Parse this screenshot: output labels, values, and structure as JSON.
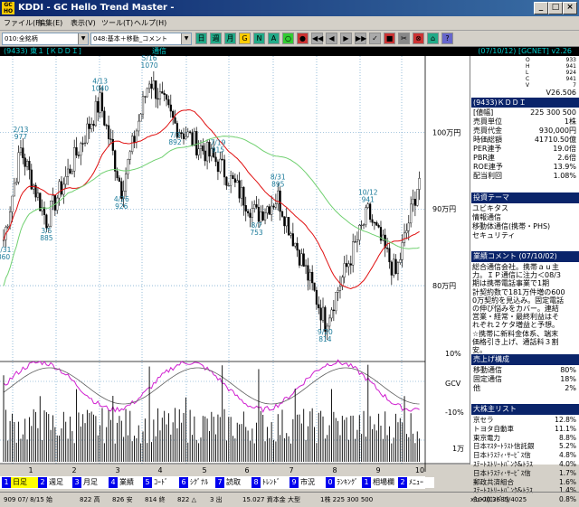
{
  "window": {
    "icon_text": "GC HO",
    "title": "KDDI - GC Hello Trend Master -",
    "btn_min": "_",
    "btn_max": "□",
    "btn_close": "×"
  },
  "menu": [
    "ファイル(F)",
    "編集(E)",
    "表示(V)",
    "ツール(T)",
    "ヘルプ(H)"
  ],
  "toolbar": {
    "combo1": "010:全銘柄",
    "combo2": "048:基本＋移動_コメント",
    "icons": [
      "日",
      "週",
      "月",
      "G",
      "N",
      "A",
      "○",
      "●",
      "◀◀",
      "◀",
      "▶",
      "▶▶",
      "✓",
      "■",
      "✂",
      "⊗",
      "⌂",
      "?"
    ]
  },
  "infobar": {
    "left": "(9433) 東１ [ＫＤＤＩ]",
    "market": "通信",
    "right": "(07/10/12) [GCNET] v2.26"
  },
  "chart": {
    "price_labels": [
      "100万円",
      "90万円",
      "80万円"
    ],
    "ind_labels": [
      "10%",
      "GCV",
      "-10%"
    ],
    "vol_label": "1万",
    "month_labels": [
      "1",
      "2",
      "3",
      "4",
      "5",
      "6",
      "7",
      "8",
      "9",
      "10"
    ],
    "annotations": [
      {
        "date": "1/31",
        "price": "860"
      },
      {
        "date": "2/13",
        "price": "977"
      },
      {
        "date": "3/5",
        "price": "885"
      },
      {
        "date": "4/13",
        "price": "1040"
      },
      {
        "date": "4/26",
        "price": "926"
      },
      {
        "date": "5/16",
        "price": "1070"
      },
      {
        "date": "7/3",
        "price": "892"
      },
      {
        "date": "7/19",
        "price": "915"
      },
      {
        "date": "8/7",
        "price": "753"
      },
      {
        "date": "8/31",
        "price": "895"
      },
      {
        "date": "9/20",
        "price": "814"
      },
      {
        "date": "10/12",
        "price": "941"
      }
    ]
  },
  "quote": {
    "ohlc": [
      [
        "O",
        "933"
      ],
      [
        "H",
        "941"
      ],
      [
        "L",
        "924"
      ],
      [
        "C",
        "941"
      ],
      [
        "V",
        "7"
      ]
    ],
    "turnover": "V26.506",
    "company": "(9433)ＫＤＤＩ",
    "rows": [
      [
        "[値幅]",
        "225 300 500"
      ],
      [
        "売買単位",
        "1株"
      ],
      [
        "売買代金",
        "930,000円"
      ],
      [
        "時価総額",
        "41710.50億"
      ],
      [
        "PER連予",
        "19.0倍"
      ],
      [
        "PBR連",
        "2.6倍"
      ],
      [
        "ROE連予",
        "13.9%"
      ],
      [
        "配当利回",
        "1.08%"
      ]
    ]
  },
  "theme": {
    "header": "投資テーマ",
    "items": [
      "ユビキタス",
      "情報通信",
      "移動体通信(携帯・PHS)",
      "セキュリティ"
    ]
  },
  "comment": {
    "header": "業績コメント (07/10/02)",
    "lines": [
      "総合通信会社。携帯ａｕ主",
      "力。ＩＰ通信に注力＜08/3",
      "期は携帯電話事業で1期",
      "計契約数で181万件増の600",
      "0万契約を見込み。固定電話",
      "の伸び悩みをカバー。連結",
      "営業・経常・最終利益はそ",
      "れぞれ２ケタ増益と予想。",
      "☆携帯に新料金体系、端末",
      "価格引き上げ、通話料３割",
      "安。"
    ]
  },
  "sales": {
    "header": "売上げ構成",
    "items": [
      [
        "移動通信",
        "80%"
      ],
      [
        "固定通信",
        "18%"
      ],
      [
        "他",
        "2%"
      ]
    ]
  },
  "holders": {
    "header": "大株主リスト",
    "items": [
      [
        "京セラ",
        "12.8%"
      ],
      [
        "トヨタ自動車",
        "11.1%"
      ],
      [
        "東京電力",
        "8.8%"
      ],
      [
        "日本ﾏｽﾀｰﾄﾗｽﾄ信託銀",
        "5.2%"
      ],
      [
        "日本ﾄﾗｽﾃｨ･ｻｰﾋﾞｽ信",
        "4.8%"
      ],
      [
        "ｽﾃｰﾄｽﾄﾘｰﾄﾊﾞﾝｸ&ﾄﾗｽ",
        "4.0%"
      ],
      [
        "日本ﾄﾗｽﾃｨ･ｻｰﾋﾞｽ信",
        "1.7%"
      ],
      [
        "郵政共済組合",
        "1.6%"
      ],
      [
        "ｽﾃｰﾄｽﾄﾘｰﾄﾊﾞﾝｸ&ﾄﾗｽ",
        "1.4%"
      ],
      [
        "ﾁｪｰｽ(ﾛﾝﾄﾞﾝ)",
        "0.8%"
      ]
    ]
  },
  "tabs": [
    [
      "1",
      "日足"
    ],
    [
      "2",
      "週足"
    ],
    [
      "3",
      "月足"
    ],
    [
      "4",
      "業績"
    ],
    [
      "5",
      "ｺｰﾄﾞ"
    ],
    [
      "6",
      "ｼｸﾞﾅﾙ"
    ],
    [
      "7",
      "読取"
    ],
    [
      "8",
      "ﾄﾚﾝﾄﾞ"
    ],
    [
      "9",
      "市況"
    ],
    [
      "0",
      "ﾗﾝｷﾝｸﾞ"
    ],
    [
      "1",
      "相場欄"
    ],
    [
      "2",
      "ﾒﾆｭｰ"
    ]
  ],
  "status": {
    "items": [
      "909 07/ 8/15 始",
      "822 高",
      "826 安",
      "814 終",
      "822 △",
      "3 出",
      "15.027 資本金 大型",
      "1株 225 300 500",
      "x1000 3685/4025"
    ]
  }
}
